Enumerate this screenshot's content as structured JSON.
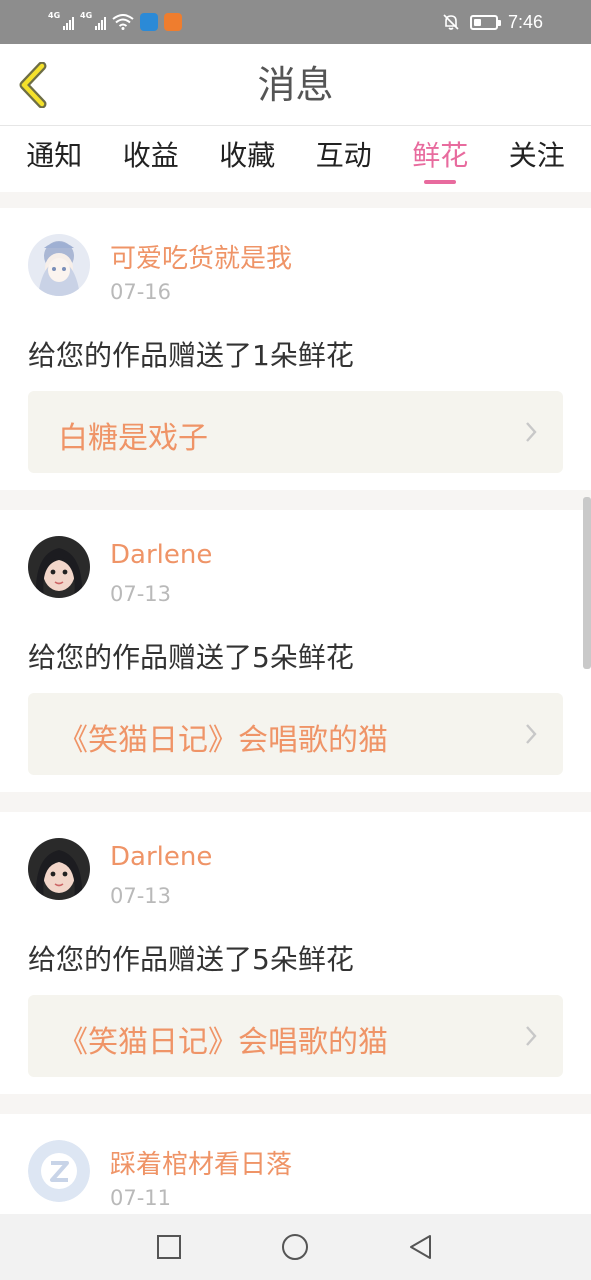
{
  "status_bar": {
    "signal1_label": "4G",
    "signal2_label": "4G",
    "time": "7:46",
    "battery_level": 0.35,
    "icons": [
      "signal-icon",
      "signal-icon",
      "wifi-icon",
      "app-icon",
      "app-icon",
      "mute-bell-icon",
      "battery-icon"
    ]
  },
  "header": {
    "title": "消息",
    "back_icon": "chevron-left-icon"
  },
  "tabs": [
    {
      "label": "通知"
    },
    {
      "label": "收益"
    },
    {
      "label": "收藏"
    },
    {
      "label": "互动"
    },
    {
      "label": "鲜花",
      "active": true
    },
    {
      "label": "关注"
    }
  ],
  "colors": {
    "accent": "#e86b9e",
    "username": "#ef9467",
    "work_bg": "#f5f4ee",
    "date": "#b9b9b9"
  },
  "feed": [
    {
      "username": "可爱吃货就是我",
      "date": "07-16",
      "message": "给您的作品赠送了1朵鲜花",
      "work_title": "白糖是戏子"
    },
    {
      "username": "Darlene",
      "date": "07-13",
      "message": "给您的作品赠送了5朵鲜花",
      "work_title": "《笑猫日记》会唱歌的猫"
    },
    {
      "username": "Darlene",
      "date": "07-13",
      "message": "给您的作品赠送了5朵鲜花",
      "work_title": "《笑猫日记》会唱歌的猫"
    },
    {
      "username": "踩着棺材看日落",
      "date": "07-11",
      "message": "",
      "work_title": ""
    }
  ],
  "nav_bar": [
    "recents-square-icon",
    "home-circle-icon",
    "back-triangle-icon"
  ]
}
